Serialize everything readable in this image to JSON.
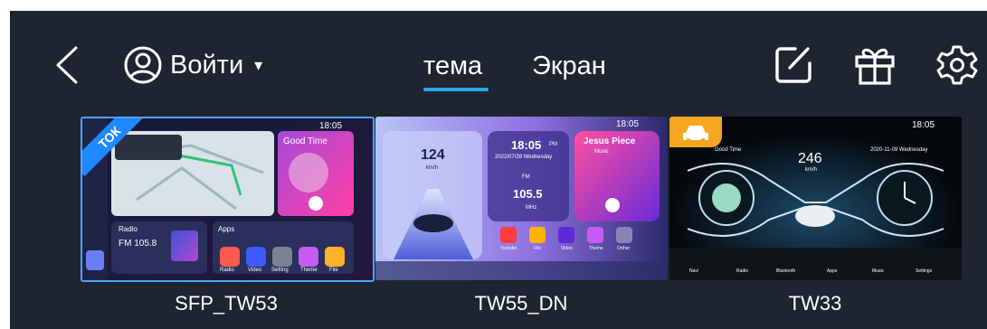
{
  "header": {
    "login_label": "Войти",
    "login_caret": "▾",
    "tabs": [
      {
        "label": "тема",
        "active": true
      },
      {
        "label": "Экран",
        "active": false
      }
    ]
  },
  "themes": [
    {
      "name": "SFP_TW53",
      "badge": "ТОК",
      "selected": true,
      "preview": {
        "time": "18:05",
        "music_title": "Good Time",
        "radio_label": "Radio",
        "radio_freq": "FM 105.8",
        "apps_label": "Apps",
        "apps": [
          "Radio",
          "Video",
          "Setting",
          "Theme",
          "File"
        ]
      }
    },
    {
      "name": "TW55_DN",
      "selected": false,
      "preview": {
        "time": "18:05",
        "speed": "124",
        "speed_unit": "km/h",
        "clock": "18:05",
        "clock_suffix": "PM",
        "date": "2022/07/28 Wednesday",
        "band": "FM",
        "freq": "105.5",
        "freq_unit": "MHz",
        "song": "Jesus Piece",
        "song_sub": "Music",
        "apps": [
          "Youtube",
          "File",
          "Video",
          "Theme",
          "Orther"
        ]
      }
    },
    {
      "name": "TW33",
      "selected": false,
      "preview": {
        "time": "18:05",
        "speed": "246",
        "speed_unit": "km/h",
        "song": "Good Time",
        "date": "2020-11-09 Wednesday",
        "dock": [
          "Navi",
          "Radio",
          "Bluetooth",
          "Apps",
          "Music",
          "Settings"
        ]
      }
    }
  ],
  "colors": {
    "background": "#1e2430",
    "accent": "#2aa6f0",
    "selection": "#4ea3ff"
  }
}
